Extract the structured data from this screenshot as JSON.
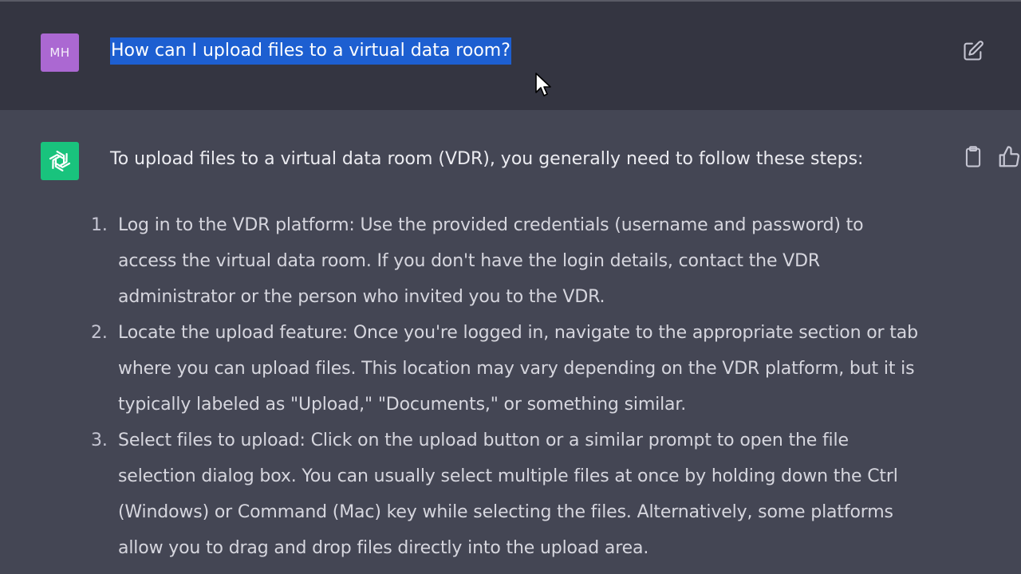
{
  "user_message": {
    "avatar_initials": "MH",
    "avatar_color": "#ab68d2",
    "text": "How can I upload files to a virtual data room?",
    "selection_color": "#1d5fd1"
  },
  "assistant_message": {
    "avatar_color": "#19c37d",
    "avatar_icon": "openai-logo-icon",
    "intro": "To upload files to a virtual data room (VDR), you generally need to follow these steps:",
    "steps": [
      {
        "number": "1.",
        "lines": [
          "Log in to the VDR platform: Use the provided credentials (username and password) to",
          "access the virtual data room. If you don't have the login details, contact the VDR",
          "administrator or the person who invited you to the VDR."
        ]
      },
      {
        "number": "2.",
        "lines": [
          "Locate the upload feature: Once you're logged in, navigate to the appropriate section or tab",
          "where you can upload files. This location may vary depending on the VDR platform, but it is",
          "typically labeled as \"Upload,\" \"Documents,\" or something similar."
        ]
      },
      {
        "number": "3.",
        "lines": [
          "Select files to upload: Click on the upload button or a similar prompt to open the file",
          "selection dialog box. You can usually select multiple files at once by holding down the Ctrl",
          "(Windows) or Command (Mac) key while selecting the files. Alternatively, some platforms",
          "allow you to drag and drop files directly into the upload area."
        ]
      }
    ]
  },
  "icons": {
    "edit": "edit-icon",
    "copy": "clipboard-icon",
    "feedback": "thumbs-up-icon",
    "cursor": "mouse-cursor-icon"
  },
  "colors": {
    "user_background": "#343541",
    "assistant_background": "#444654"
  }
}
